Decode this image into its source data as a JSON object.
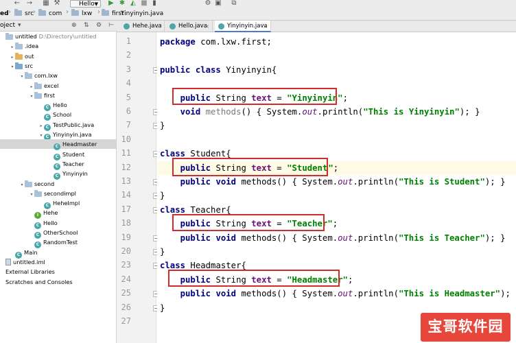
{
  "breadcrumb": {
    "items": [
      "ed",
      "src",
      "com",
      "lxw",
      "first",
      "Yinyinyin.java"
    ]
  },
  "toolbar": {
    "run_config": "Hello",
    "icons": [
      "back-icon",
      "forward-icon",
      "project-structure-icon",
      "build-icon",
      "run-icon",
      "debug-icon",
      "coverage-icon",
      "stop-icon",
      "wrench-icon",
      "sdk-icon",
      "layout-icon"
    ]
  },
  "project_panel": {
    "title": "oject",
    "header_icons": [
      "dropdown-icon",
      "target-icon",
      "collapse-icon",
      "settings-icon",
      "hide-icon"
    ]
  },
  "tree": [
    {
      "label": "untitled",
      "note": "D:\\Directory\\untitled",
      "indent": 0,
      "icon": "folder",
      "arrow": "",
      "selected": false
    },
    {
      "label": ".idea",
      "indent": 1,
      "icon": "folder",
      "arrow": "›",
      "selected": false
    },
    {
      "label": "out",
      "indent": 1,
      "icon": "folder-orange",
      "arrow": "›",
      "selected": false
    },
    {
      "label": "src",
      "indent": 1,
      "icon": "folder-src",
      "arrow": "⌄",
      "selected": false
    },
    {
      "label": "com.lxw",
      "indent": 2,
      "icon": "folder",
      "arrow": "⌄",
      "selected": false
    },
    {
      "label": "excel",
      "indent": 3,
      "icon": "folder",
      "arrow": "›",
      "selected": false
    },
    {
      "label": "first",
      "indent": 3,
      "icon": "folder",
      "arrow": "⌄",
      "selected": false
    },
    {
      "label": "Hello",
      "indent": 4,
      "icon": "class",
      "arrow": "",
      "selected": false
    },
    {
      "label": "School",
      "indent": 4,
      "icon": "class",
      "arrow": "",
      "selected": false
    },
    {
      "label": "TestPublic.java",
      "indent": 4,
      "icon": "class",
      "arrow": "›",
      "selected": false
    },
    {
      "label": "Yinyinyin.java",
      "indent": 4,
      "icon": "class",
      "arrow": "⌄",
      "selected": false
    },
    {
      "label": "Headmaster",
      "indent": 5,
      "icon": "class",
      "arrow": "",
      "selected": true
    },
    {
      "label": "Student",
      "indent": 5,
      "icon": "class",
      "arrow": "",
      "selected": false
    },
    {
      "label": "Teacher",
      "indent": 5,
      "icon": "class",
      "arrow": "",
      "selected": false
    },
    {
      "label": "Yinyinyin",
      "indent": 5,
      "icon": "class",
      "arrow": "",
      "selected": false
    },
    {
      "label": "second",
      "indent": 2,
      "icon": "folder",
      "arrow": "⌄",
      "selected": false
    },
    {
      "label": "secondimpl",
      "indent": 3,
      "icon": "folder",
      "arrow": "⌄",
      "selected": false
    },
    {
      "label": "HeheImpl",
      "indent": 4,
      "icon": "class",
      "arrow": "",
      "selected": false
    },
    {
      "label": "Hehe",
      "indent": 3,
      "icon": "class-green",
      "arrow": "",
      "selected": false
    },
    {
      "label": "Hello",
      "indent": 3,
      "icon": "class",
      "arrow": "",
      "selected": false
    },
    {
      "label": "OtherSchool",
      "indent": 3,
      "icon": "class",
      "arrow": "",
      "selected": false
    },
    {
      "label": "RandomTest",
      "indent": 3,
      "icon": "class",
      "arrow": "",
      "selected": false
    },
    {
      "label": "Main",
      "indent": 1,
      "icon": "class",
      "arrow": "",
      "selected": false
    },
    {
      "label": "untitled.iml",
      "indent": 0,
      "icon": "file",
      "arrow": "",
      "selected": false
    },
    {
      "label": "External Libraries",
      "indent": 0,
      "icon": "",
      "arrow": "",
      "selected": false
    },
    {
      "label": "Scratches and Consoles",
      "indent": 0,
      "icon": "",
      "arrow": "",
      "selected": false
    }
  ],
  "tabs": [
    {
      "label": "Hehe.java",
      "active": false
    },
    {
      "label": "Hello.java",
      "active": false
    },
    {
      "label": "Yinyinyin.java",
      "active": true
    }
  ],
  "code": [
    {
      "n": "1",
      "tokens": [
        [
          "kw",
          "package"
        ],
        [
          "",
          " com.lxw.first;"
        ]
      ]
    },
    {
      "n": "2",
      "tokens": []
    },
    {
      "n": "3",
      "tokens": [
        [
          "kw",
          "public class"
        ],
        [
          "",
          " Yinyinyin{"
        ]
      ]
    },
    {
      "n": "4",
      "tokens": []
    },
    {
      "n": "5",
      "tokens": [
        [
          "",
          "    "
        ],
        [
          "kw",
          "public"
        ],
        [
          "",
          " String "
        ],
        [
          "fld",
          "text"
        ],
        [
          "",
          " = "
        ],
        [
          "str",
          "\"Yinyinyin\""
        ],
        [
          "",
          ";"
        ]
      ]
    },
    {
      "n": "6",
      "tokens": [
        [
          "",
          "    "
        ],
        [
          "kw",
          "void"
        ],
        [
          "",
          " "
        ],
        [
          "dim",
          "methods"
        ],
        [
          "",
          "() { System."
        ],
        [
          "st",
          "out"
        ],
        [
          "",
          ".println("
        ],
        [
          "str",
          "\"This is Yinyinyin\""
        ],
        [
          "",
          "); }"
        ]
      ]
    },
    {
      "n": "7",
      "tokens": [
        [
          "",
          "}"
        ]
      ]
    },
    {
      "n": "10",
      "tokens": []
    },
    {
      "n": "11",
      "tokens": [
        [
          "kw",
          "class"
        ],
        [
          "",
          " Student{"
        ]
      ]
    },
    {
      "n": "12",
      "tokens": [
        [
          "",
          "    "
        ],
        [
          "kw",
          "public"
        ],
        [
          "",
          " String "
        ],
        [
          "fld",
          "text"
        ],
        [
          "",
          " = "
        ],
        [
          "str",
          "\"Student"
        ],
        [
          "cursor",
          ""
        ],
        [
          "str",
          "\""
        ],
        [
          "",
          ";"
        ]
      ]
    },
    {
      "n": "13",
      "tokens": [
        [
          "",
          "    "
        ],
        [
          "kw",
          "public void"
        ],
        [
          "",
          " methods() { System."
        ],
        [
          "st",
          "out"
        ],
        [
          "",
          ".println("
        ],
        [
          "str",
          "\"This is Student\""
        ],
        [
          "",
          "); }"
        ]
      ]
    },
    {
      "n": "14",
      "tokens": [
        [
          "",
          "}"
        ]
      ]
    },
    {
      "n": "17",
      "tokens": [
        [
          "kw",
          "class"
        ],
        [
          "",
          " Teacher{"
        ]
      ]
    },
    {
      "n": "18",
      "tokens": [
        [
          "",
          "    "
        ],
        [
          "kw",
          "public"
        ],
        [
          "",
          " String "
        ],
        [
          "fld",
          "text"
        ],
        [
          "",
          " = "
        ],
        [
          "str",
          "\"Teacher\""
        ],
        [
          "",
          ";"
        ]
      ]
    },
    {
      "n": "19",
      "tokens": [
        [
          "",
          "    "
        ],
        [
          "kw",
          "public void"
        ],
        [
          "",
          " methods() { System."
        ],
        [
          "st",
          "out"
        ],
        [
          "",
          ".println("
        ],
        [
          "str",
          "\"This is Teacher\""
        ],
        [
          "",
          "); }"
        ]
      ]
    },
    {
      "n": "20",
      "tokens": [
        [
          "",
          "}"
        ]
      ]
    },
    {
      "n": "23",
      "tokens": [
        [
          "kw",
          "class"
        ],
        [
          "",
          " Headmaster{"
        ]
      ]
    },
    {
      "n": "24",
      "tokens": [
        [
          "",
          "    "
        ],
        [
          "kw",
          "public"
        ],
        [
          "",
          " String "
        ],
        [
          "fld",
          "text"
        ],
        [
          "",
          " = "
        ],
        [
          "str",
          "\"Headmaster\""
        ],
        [
          "",
          ";"
        ]
      ]
    },
    {
      "n": "25",
      "tokens": [
        [
          "",
          "    "
        ],
        [
          "kw",
          "public void"
        ],
        [
          "",
          " methods() { System."
        ],
        [
          "st",
          "out"
        ],
        [
          "",
          ".println("
        ],
        [
          "str",
          "\"This is Headmaster\""
        ],
        [
          "",
          "); }"
        ]
      ]
    },
    {
      "n": "26",
      "tokens": [
        [
          "",
          "}"
        ]
      ]
    },
    {
      "n": "27",
      "tokens": []
    }
  ],
  "watermark": {
    "text": "宝哥软件园"
  }
}
